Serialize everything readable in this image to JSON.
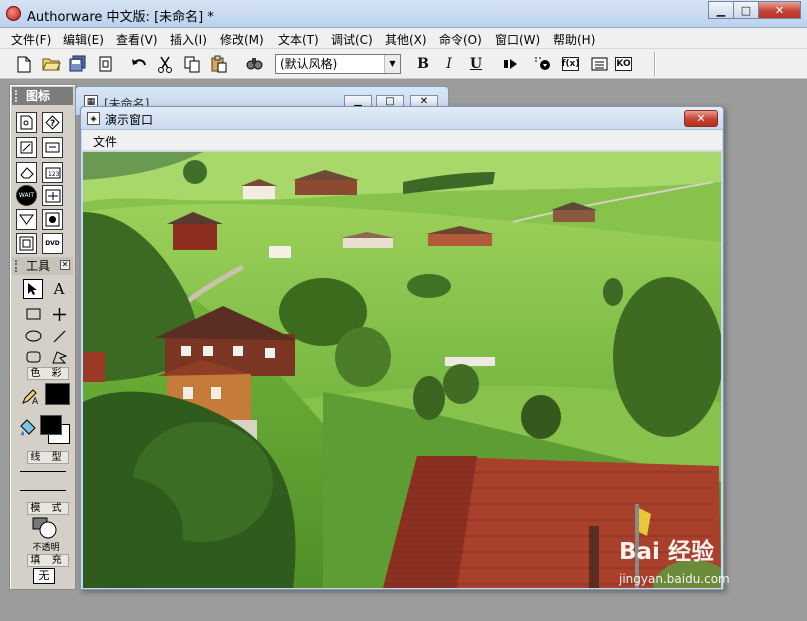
{
  "app": {
    "title": "Authorware 中文版: [未命名] *"
  },
  "window_controls": {
    "minimize": "▁",
    "maximize": "□",
    "close": "✕"
  },
  "menu": [
    "文件(F)",
    "编辑(E)",
    "查看(V)",
    "插入(I)",
    "修改(M)",
    "文本(T)",
    "调试(C)",
    "其他(X)",
    "命令(O)",
    "窗口(W)",
    "帮助(H)"
  ],
  "toolbar": {
    "style_select": {
      "value": "(默认风格)"
    },
    "bold": "B",
    "italic": "I",
    "underline": "U",
    "func_label": "f(x)",
    "ko_label": "KO",
    "icons": [
      "new-icon",
      "open-icon",
      "save-all-icon",
      "import-icon",
      "undo-icon",
      "cut-icon",
      "copy-icon",
      "paste-icon",
      "find-icon",
      "run-icon",
      "control-panel-icon",
      "functions-icon",
      "variables-icon",
      "knowledge-objects-icon"
    ]
  },
  "palette": {
    "icons_title": "图标",
    "tools_title": "工具",
    "wait_label": "WAIT",
    "dvd_label": "DVD",
    "color_label": "色 彩",
    "line_label": "线 型",
    "mode_label": "模 式",
    "mode_value": "不透明",
    "fill_label": "填 充",
    "fill_value": "无",
    "colors": {
      "pen": "#000000",
      "foreground": "#000000",
      "background": "#ffffff"
    }
  },
  "design_window": {
    "title": "[未命名]"
  },
  "presentation": {
    "title": "演示窗口",
    "close": "✕",
    "menu": [
      "文件"
    ]
  },
  "watermark": {
    "brand": "Bai 经验",
    "url": "jingyan.baidu.com"
  }
}
